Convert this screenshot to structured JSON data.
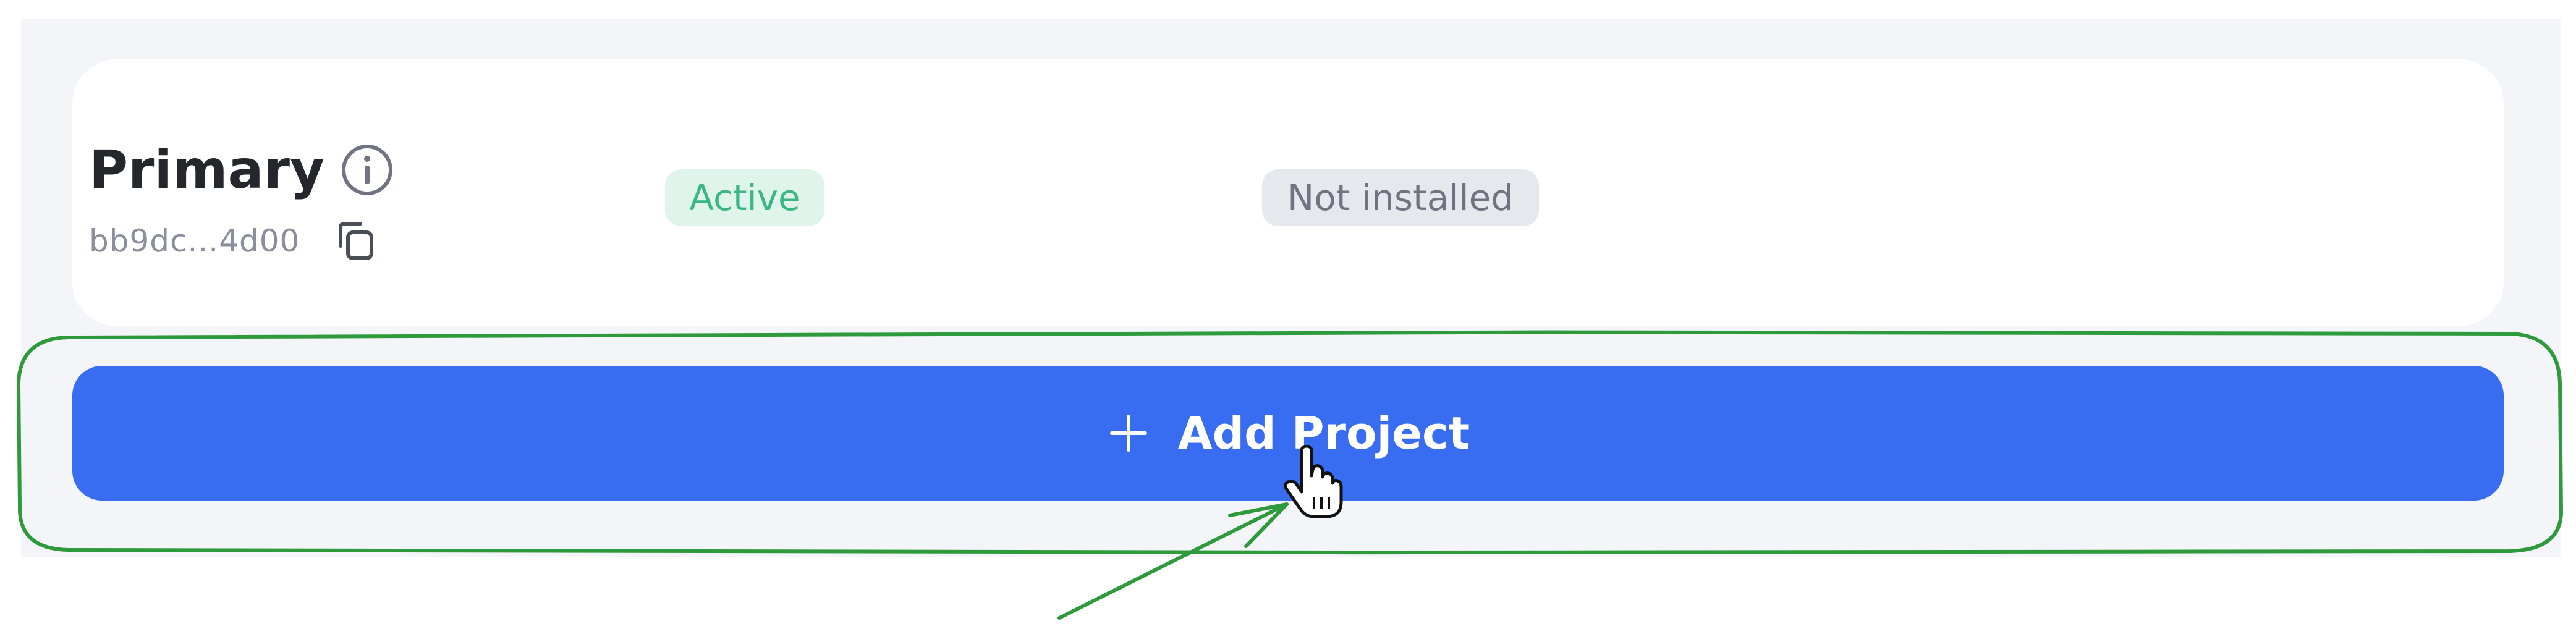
{
  "project": {
    "name": "Primary",
    "id_short": "bb9dc...4d00",
    "status": "Active",
    "install_status": "Not installed"
  },
  "actions": {
    "add_project_label": "Add Project"
  },
  "icons": {
    "info": "info-icon",
    "copy": "copy-icon",
    "plus": "plus-icon",
    "cursor": "hand-pointer-cursor"
  },
  "colors": {
    "page_band": "#f3f5f9",
    "card": "#ffffff",
    "title_text": "#25272d",
    "muted_text": "#8a8f9b",
    "active_bg": "#dff5eb",
    "active_text": "#3cb783",
    "install_bg": "#e6e8ee",
    "install_text": "#6f7480",
    "button": "#386df2",
    "annotation": "#2e9a3c"
  }
}
